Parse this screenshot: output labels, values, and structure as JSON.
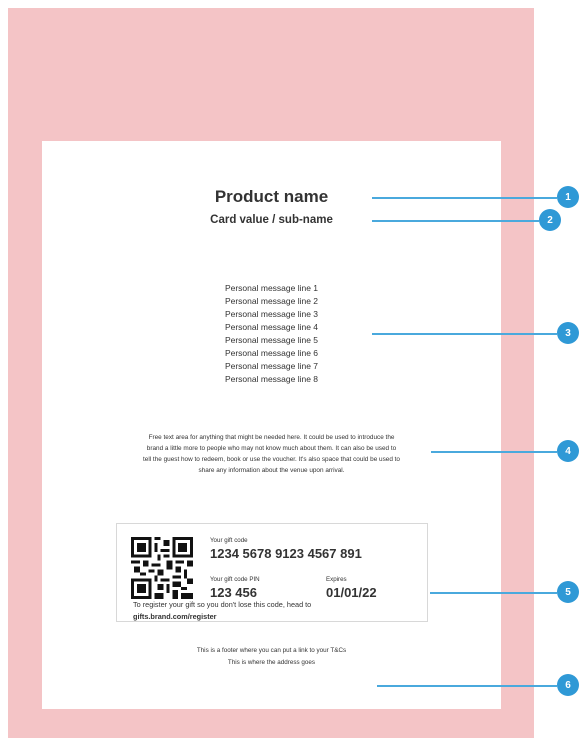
{
  "card": {
    "product_name": "Product name",
    "card_value": "Card value / sub-name",
    "messages": [
      "Personal message line 1",
      "Personal message line 2",
      "Personal message line 3",
      "Personal message line 4",
      "Personal message line 5",
      "Personal message line 6",
      "Personal message line 7",
      "Personal message line 8"
    ],
    "free_text": [
      "Free text area for anything that might be needed here. It could be used to introduce the",
      "brand a little more to people who may not know much about them. It can also be used to",
      "tell the guest how to redeem, book or use the voucher. It's also space that could be used to",
      "share any information about the venue upon arrival."
    ],
    "gift": {
      "code_label": "Your gift code",
      "code": "1234 5678 9123 4567 891",
      "pin_label": "Your gift code PIN",
      "pin": "123 456",
      "expires_label": "Expires",
      "expires": "01/01/22",
      "register_text": "To register your gift so you don't lose this code, head to",
      "register_link": "gifts.brand.com/register"
    },
    "footer": [
      "This is a footer where you can put a link to your T&Cs",
      "This is where the address goes"
    ]
  },
  "callouts": [
    "1",
    "2",
    "3",
    "4",
    "5",
    "6"
  ],
  "colors": {
    "background": "#f4c4c6",
    "accent": "#2f99d6"
  }
}
